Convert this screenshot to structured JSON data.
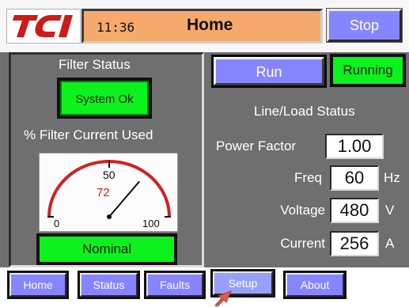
{
  "header": {
    "logo_text": "TCI",
    "time": "11:36",
    "title": "Home",
    "stop_label": "Stop"
  },
  "filter": {
    "status_label": "Filter Status",
    "status_value": "System Ok",
    "current_used_label": "% Filter Current Used",
    "gauge": {
      "min_label": "0",
      "mid_label": "50",
      "max_label": "100",
      "value": 72,
      "value_label": "72"
    },
    "condition": "Nominal"
  },
  "control": {
    "run_label": "Run",
    "state": "Running"
  },
  "line_load": {
    "title": "Line/Load Status",
    "power_factor_label": "Power Factor",
    "power_factor_value": "1.00",
    "freq_label": "Freq",
    "freq_value": "60",
    "freq_unit": "Hz",
    "voltage_label": "Voltage",
    "voltage_value": "480",
    "voltage_unit": "V",
    "current_label": "Current",
    "current_value": "256",
    "current_unit": "A"
  },
  "nav": {
    "home": "Home",
    "status": "Status",
    "faults": "Faults",
    "setup": "Setup",
    "about": "About"
  },
  "colors": {
    "header_bar": "#f5a96a",
    "button_blue": "#8585ff",
    "indicator_green": "#0cf21c",
    "panel_gray": "#6f6f6f",
    "gauge_red": "#d42020",
    "logo_red": "#cc1b1b"
  }
}
